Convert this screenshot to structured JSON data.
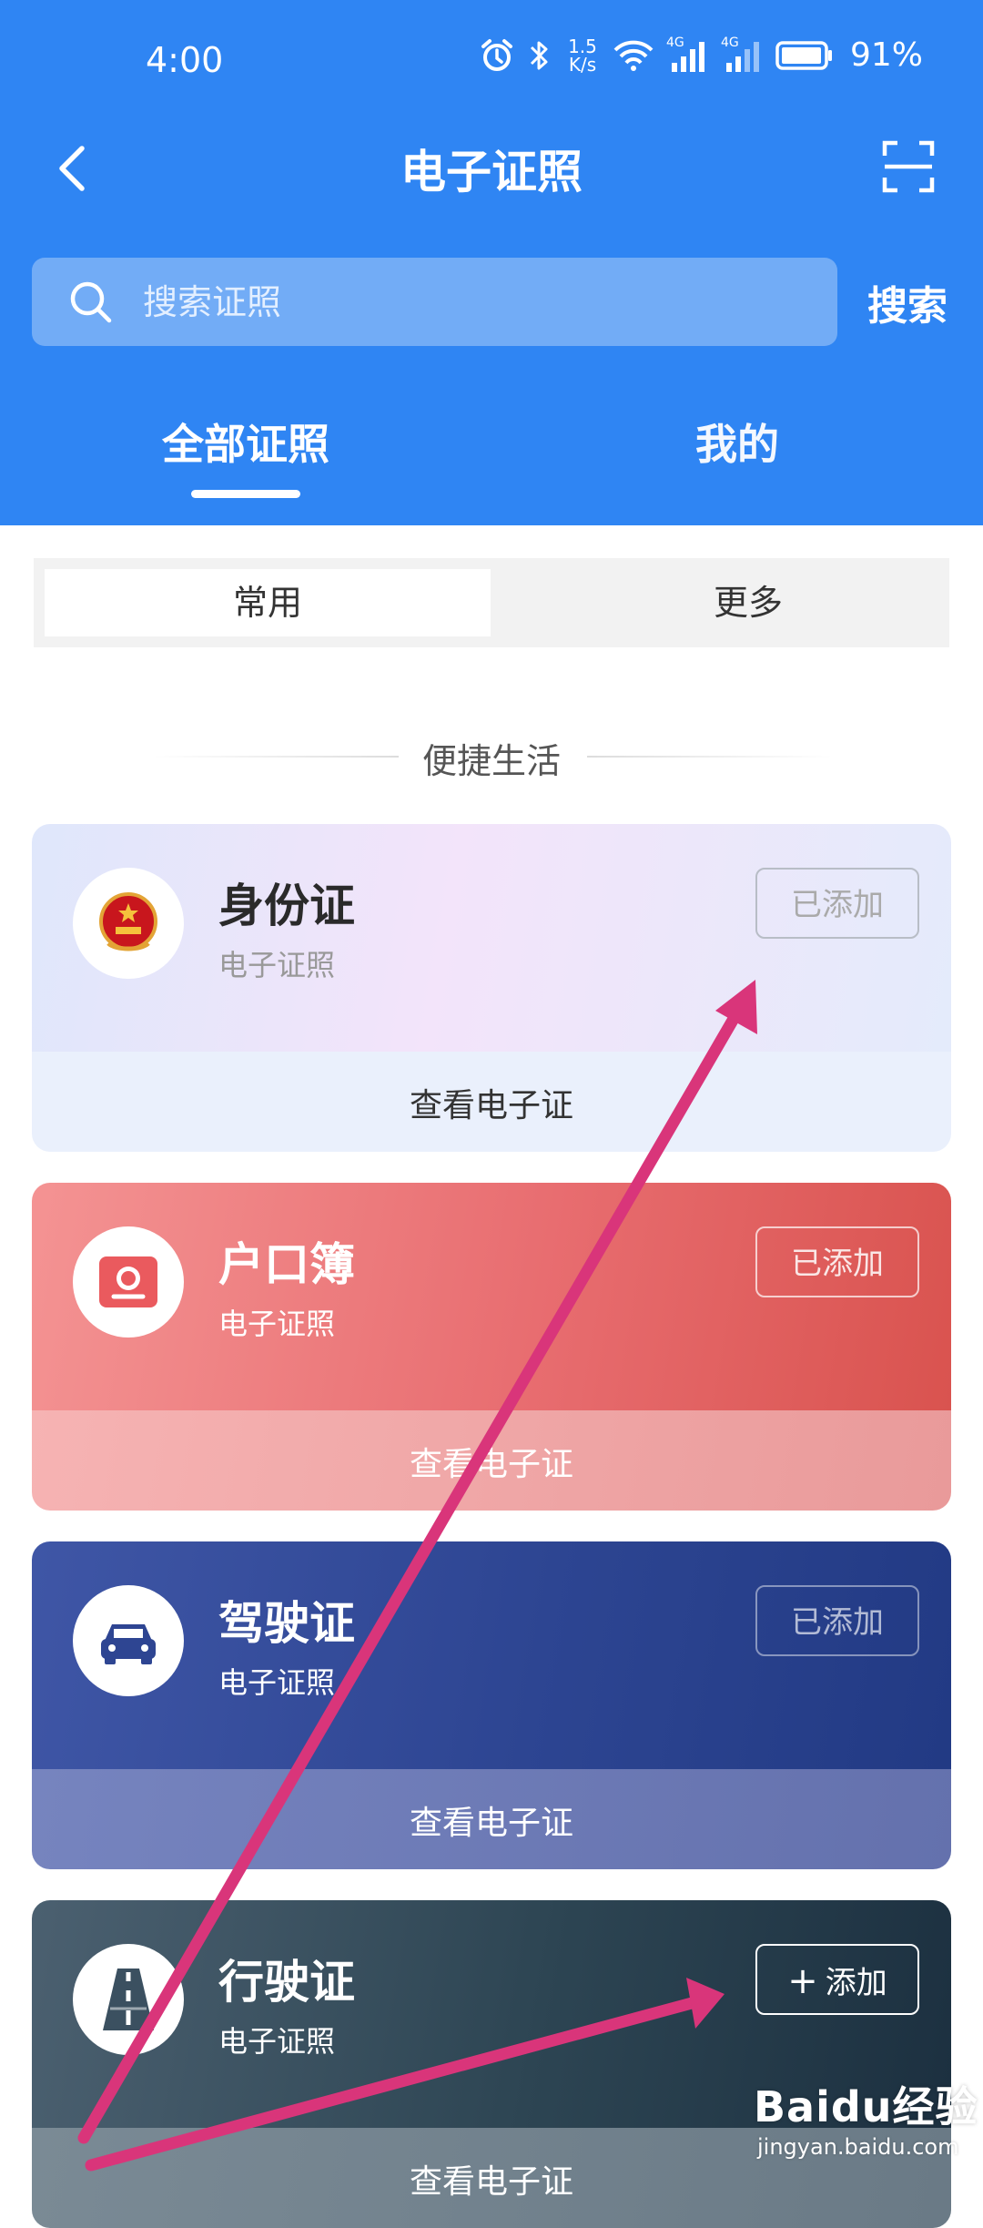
{
  "status_bar": {
    "time": "4:00",
    "net_speed_value": "1.5",
    "net_speed_unit": "K/s",
    "net_type_1": "4G",
    "net_type_2": "4G",
    "battery": "91%",
    "icons": [
      "alarm-icon",
      "bluetooth-icon",
      "wifi-icon",
      "signal-icon",
      "signal-icon",
      "battery-icon"
    ]
  },
  "nav": {
    "title": "电子证照",
    "back_icon": "chevron-left-icon",
    "scan_icon": "scan-icon"
  },
  "search": {
    "placeholder": "搜索证照",
    "button_label": "搜索"
  },
  "tabs": [
    {
      "label": "全部证照",
      "active": true
    },
    {
      "label": "我的",
      "active": false
    }
  ],
  "segment": [
    {
      "label": "常用",
      "active": true
    },
    {
      "label": "更多",
      "active": false
    }
  ],
  "section": {
    "title": "便捷生活"
  },
  "cards": [
    {
      "title": "身份证",
      "subtitle": "电子证照",
      "status": "已添加",
      "action": "查看电子证",
      "icon": "national-emblem-icon"
    },
    {
      "title": "户口簿",
      "subtitle": "电子证照",
      "status": "已添加",
      "action": "查看电子证",
      "icon": "household-register-icon"
    },
    {
      "title": "驾驶证",
      "subtitle": "电子证照",
      "status": "已添加",
      "action": "查看电子证",
      "icon": "car-icon"
    },
    {
      "title": "行驶证",
      "subtitle": "电子证照",
      "status": "添加",
      "status_icon": "plus-icon",
      "action": "查看电子证",
      "icon": "road-icon"
    }
  ],
  "colors": {
    "header_bg": "#2f85f3",
    "annotation_arrow": "#d9357a"
  },
  "watermark": {
    "logo": "Baidu经验",
    "url": "jingyan.baidu.com"
  }
}
